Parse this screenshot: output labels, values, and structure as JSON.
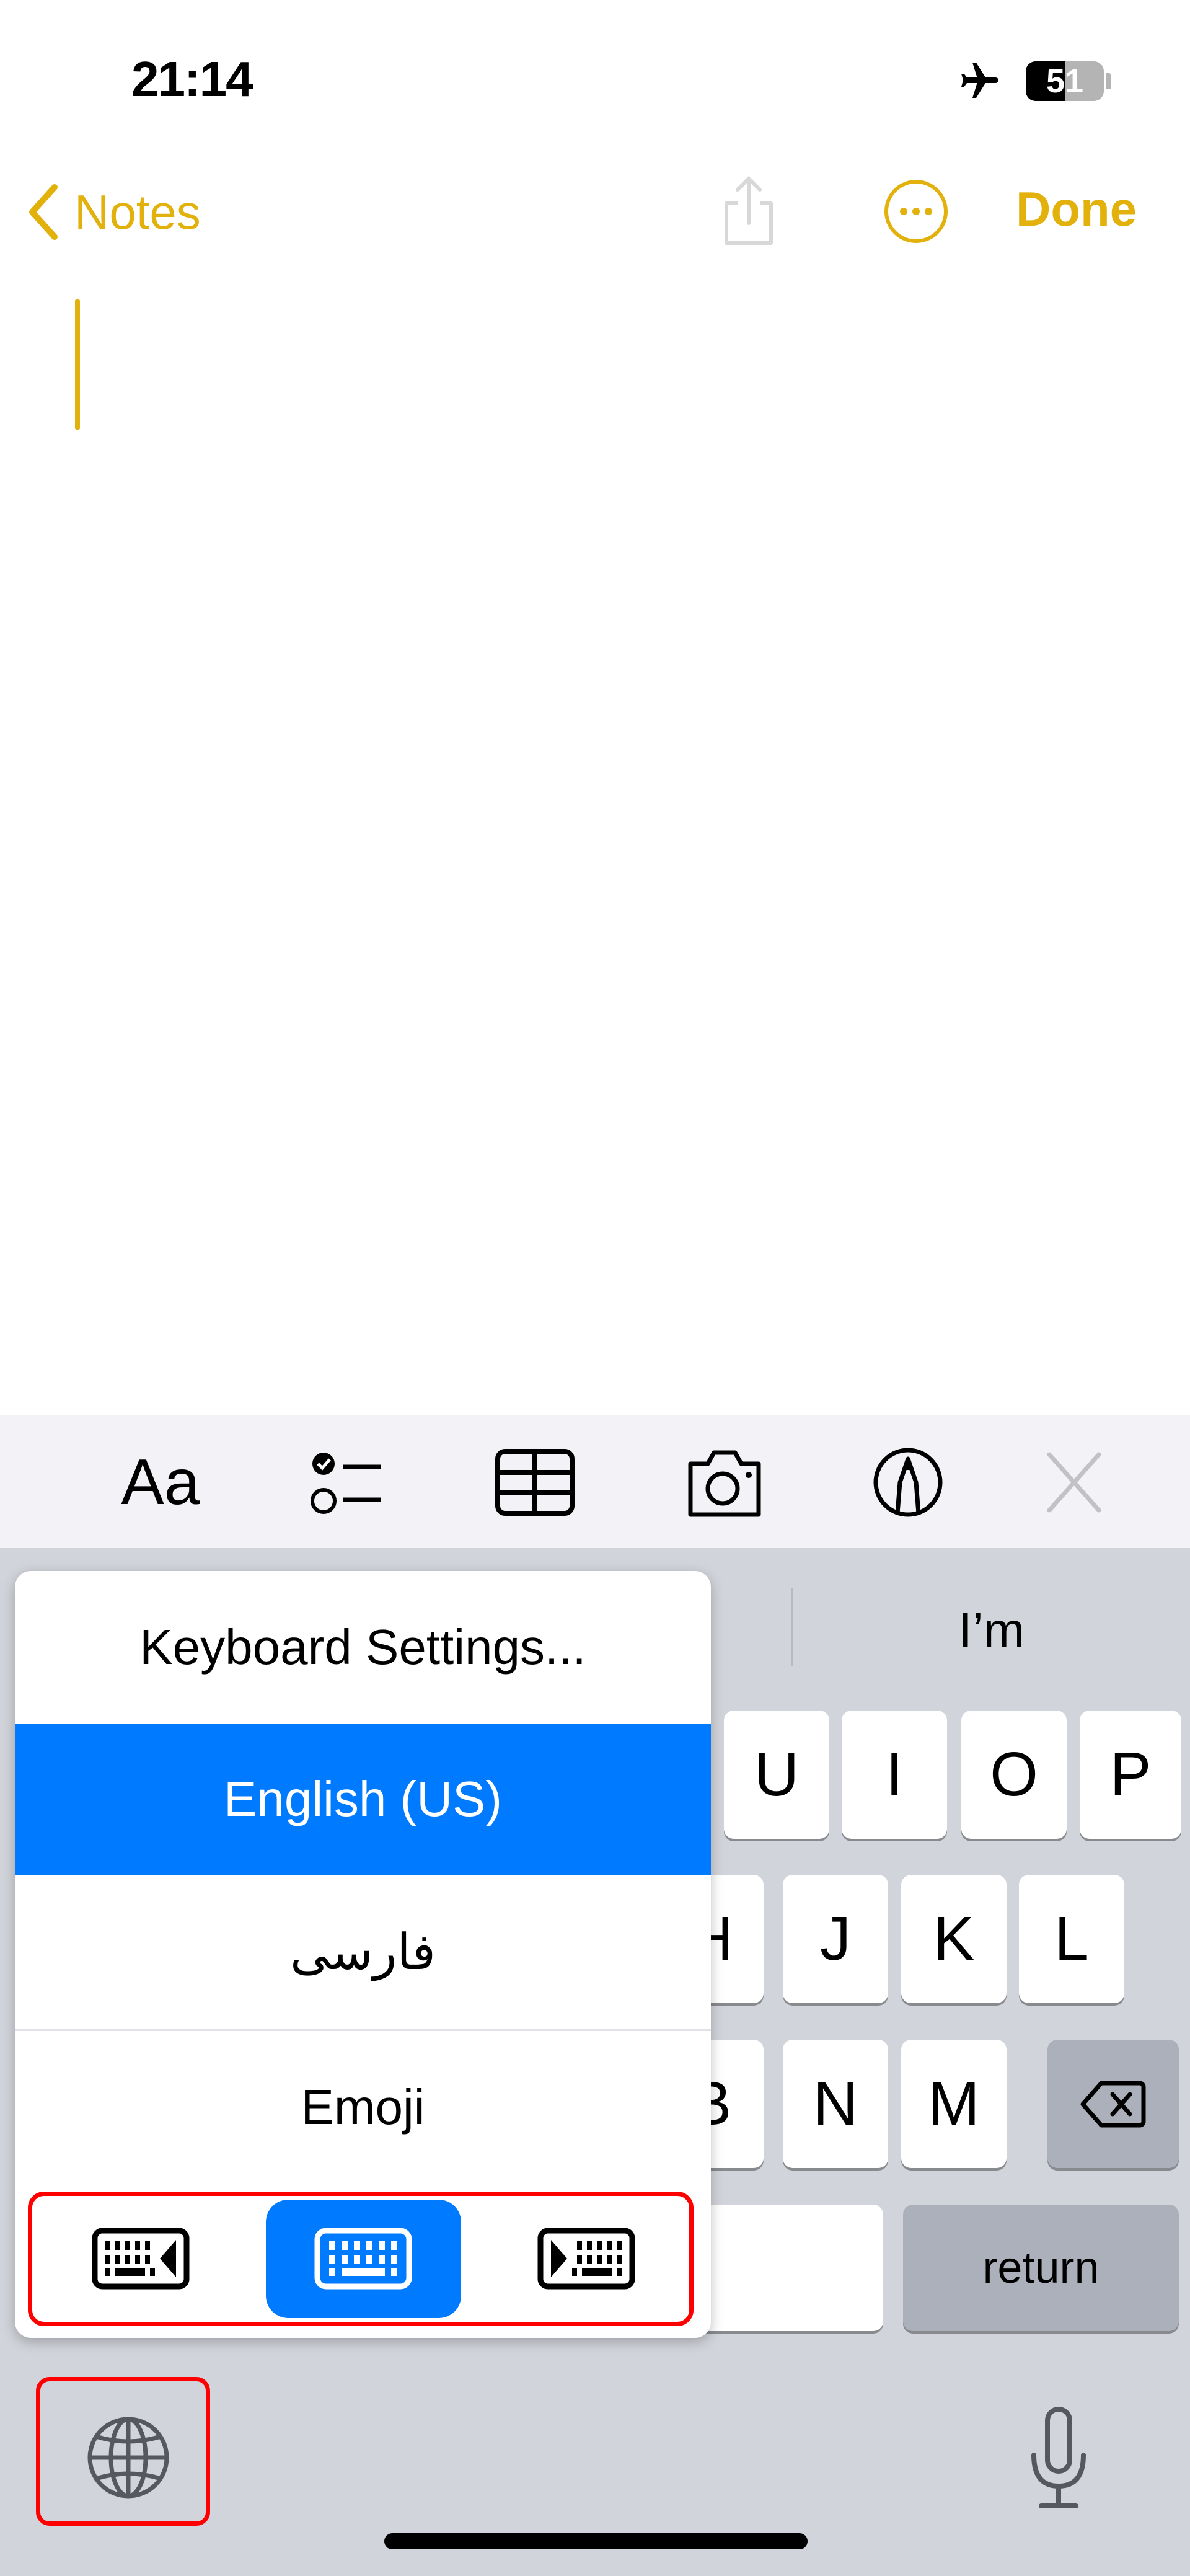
{
  "status_bar": {
    "time": "21:14",
    "battery": "51",
    "icons": [
      "airplane-mode-icon",
      "battery-icon"
    ]
  },
  "nav": {
    "back_label": "Notes",
    "done_label": "Done",
    "icons": [
      "chevron-left-icon",
      "share-icon",
      "more-icon"
    ]
  },
  "toolbar": {
    "format_label": "Aa",
    "icons": [
      "checklist-icon",
      "table-icon",
      "camera-icon",
      "markup-icon",
      "close-icon"
    ]
  },
  "predictive": {
    "suggestion": "I’m"
  },
  "keys": {
    "row1": [
      "U",
      "I",
      "O",
      "P"
    ],
    "row2": [
      "H",
      "J",
      "K",
      "L"
    ],
    "row3": [
      "B",
      "N",
      "M"
    ],
    "return_label": "return"
  },
  "language_menu": {
    "items": [
      {
        "label": "Keyboard Settings..."
      },
      {
        "label": "English (US)",
        "selected": true
      },
      {
        "label": "فارسی"
      },
      {
        "label": "Emoji"
      }
    ],
    "layout_options": [
      "keyboard-left-icon",
      "keyboard-full-icon",
      "keyboard-right-icon"
    ],
    "selected_layout": "keyboard-full-icon"
  },
  "colors": {
    "accent": "#e2b10c",
    "selection": "#007aff",
    "highlight_box": "#ff0000"
  }
}
